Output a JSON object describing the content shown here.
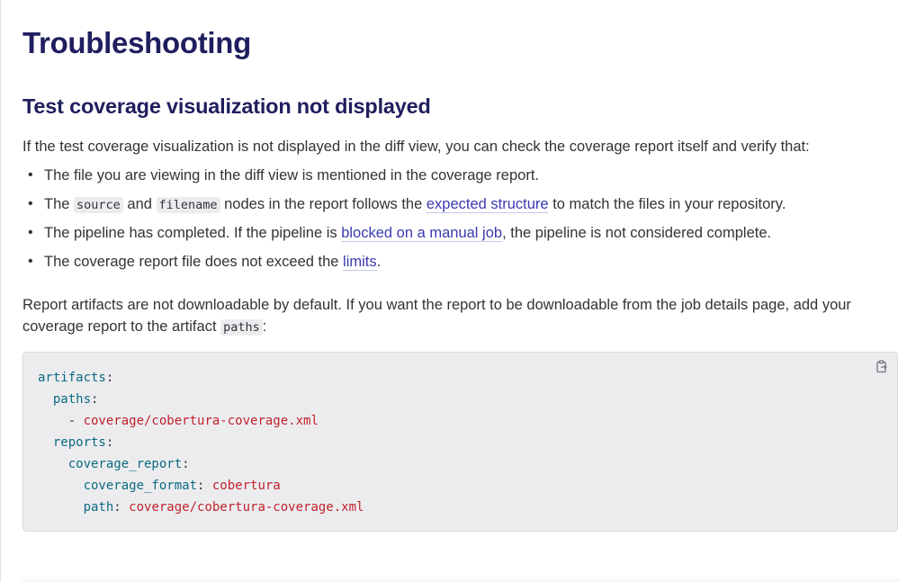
{
  "page": {
    "title": "Troubleshooting",
    "section_title": "Test coverage visualization not displayed",
    "intro": "If the test coverage visualization is not displayed in the diff view, you can check the coverage report itself and verify that:"
  },
  "checklist": {
    "item1": "The file you are viewing in the diff view is mentioned in the coverage report.",
    "item2": {
      "pre": "The ",
      "code1": "source",
      "mid": " and ",
      "code2": "filename",
      "post": " nodes in the report follows the ",
      "link": "expected structure",
      "tail": " to match the files in your repository."
    },
    "item3": {
      "pre": "The pipeline has completed. If the pipeline is ",
      "link": "blocked on a manual job",
      "tail": ", the pipeline is not considered complete."
    },
    "item4": {
      "pre": "The coverage report file does not exceed the ",
      "link": "limits",
      "tail": "."
    }
  },
  "artifacts_note": {
    "text": "Report artifacts are not downloadable by default. If you want the report to be downloadable from the job details page, add your coverage report to the artifact ",
    "code": "paths",
    "tail": ":"
  },
  "code_block": {
    "artifacts_key": "artifacts",
    "paths_key": "paths",
    "path_value": "coverage/cobertura-coverage.xml",
    "reports_key": "reports",
    "coverage_report_key": "coverage_report",
    "coverage_format_key": "coverage_format",
    "coverage_format_value": "cobertura",
    "path_key": "path",
    "path_value2": "coverage/cobertura-coverage.xml"
  },
  "icons": {
    "copy": "copy-to-clipboard-icon"
  },
  "colors": {
    "heading": "#1f1e5e",
    "link": "#3a3ab0",
    "code_key": "#0b6b80",
    "code_string": "#c0232b",
    "code_bg": "#ececef"
  }
}
